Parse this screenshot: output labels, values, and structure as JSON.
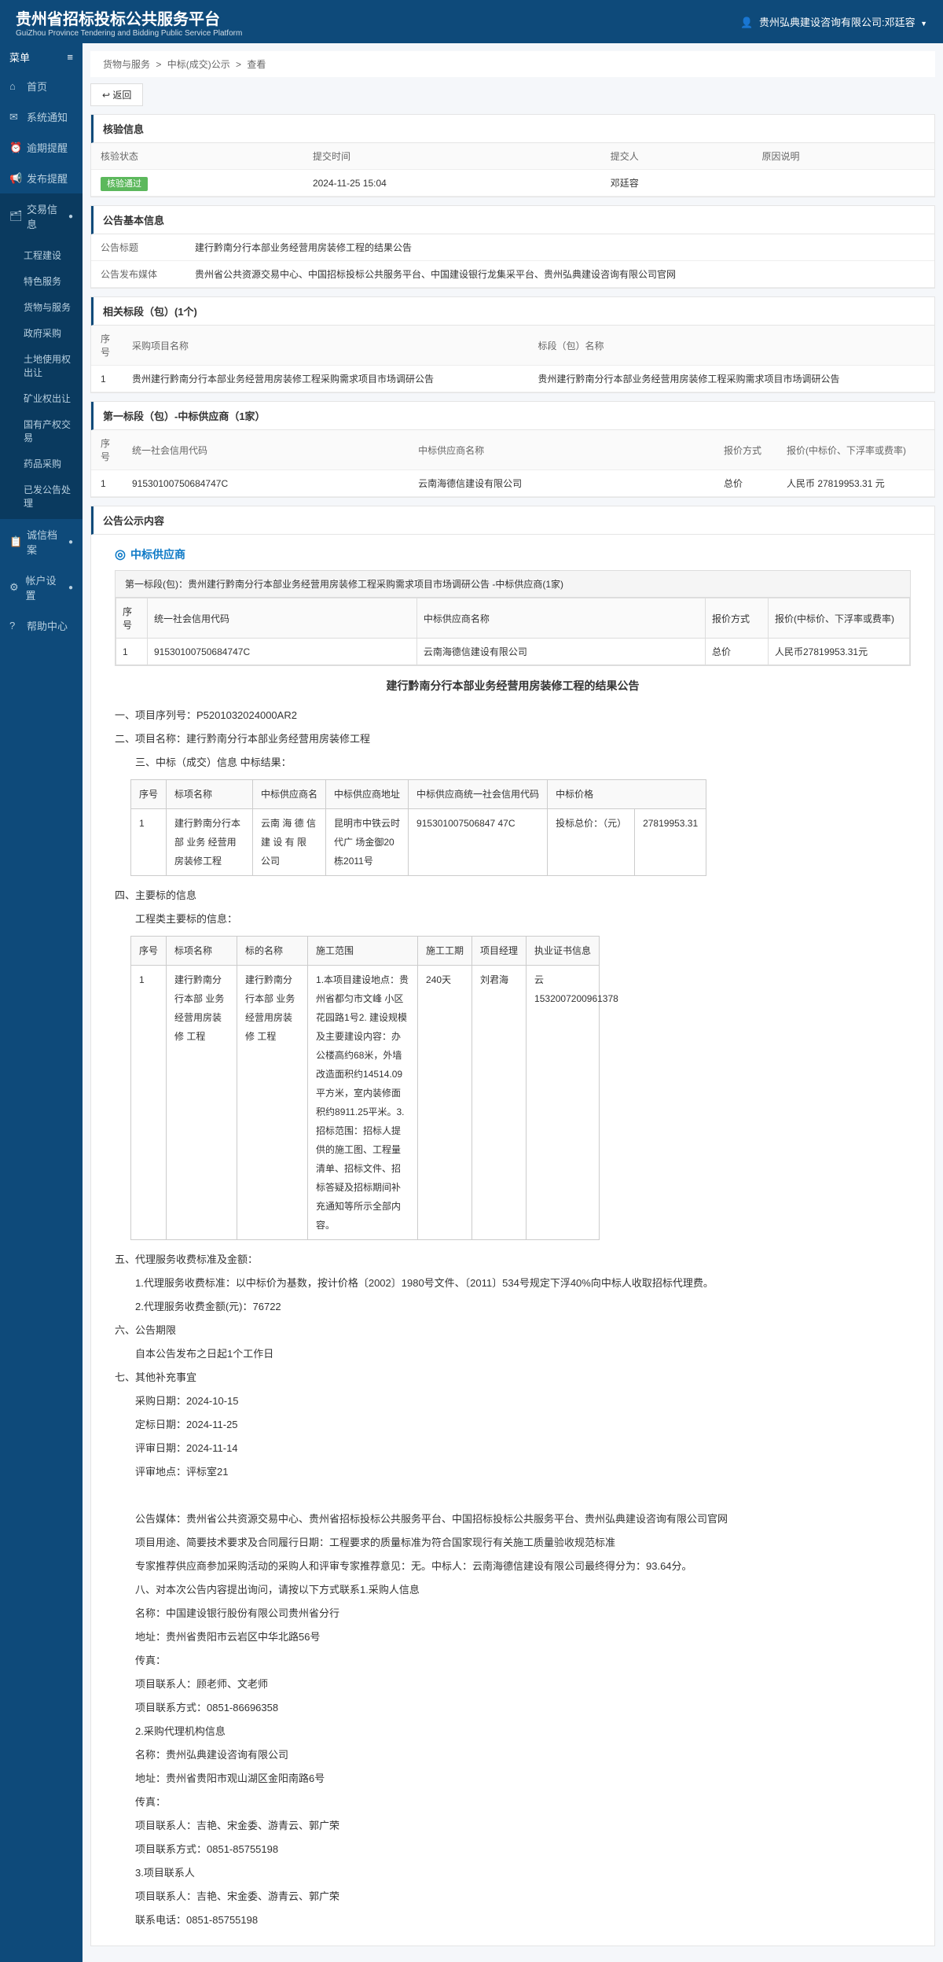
{
  "header": {
    "title_cn": "贵州省招标投标公共服务平台",
    "title_en": "GuiZhou Province Tendering and Bidding Public Service Platform",
    "user": "贵州弘典建设咨询有限公司:邓廷容"
  },
  "sidebar": {
    "title": "菜单",
    "items": [
      {
        "icon": "⌂",
        "label": "首页"
      },
      {
        "icon": "✉",
        "label": "系统通知"
      },
      {
        "icon": "⏰",
        "label": "逾期提醒"
      },
      {
        "icon": "📢",
        "label": "发布提醒"
      },
      {
        "icon": "🗂",
        "label": "交易信息",
        "active": true,
        "expand": "●"
      },
      {
        "icon": "📋",
        "label": "诚信档案",
        "expand": "●"
      },
      {
        "icon": "⚙",
        "label": "帐户设置",
        "expand": "●"
      },
      {
        "icon": "?",
        "label": "帮助中心"
      }
    ],
    "submenu": [
      "工程建设",
      "特色服务",
      "货物与服务",
      "政府采购",
      "土地使用权出让",
      "矿业权出让",
      "国有产权交易",
      "药品采购",
      "已发公告处理"
    ]
  },
  "breadcrumb": {
    "p1": "货物与服务",
    "p2": "中标(成交)公示",
    "p3": "查看"
  },
  "back_btn": "返回",
  "panel1": {
    "title": "核验信息",
    "h1": "核验状态",
    "h2": "提交时间",
    "h3": "提交人",
    "h4": "原因说明",
    "status": "核验通过",
    "time": "2024-11-25 15:04",
    "person": "邓廷容",
    "reason": ""
  },
  "panel2": {
    "title": "公告基本信息",
    "r1_label": "公告标题",
    "r1_val": "建行黔南分行本部业务经营用房装修工程的结果公告",
    "r2_label": "公告发布媒体",
    "r2_val": "贵州省公共资源交易中心、中国招标投标公共服务平台、中国建设银行龙集采平台、贵州弘典建设咨询有限公司官网"
  },
  "panel3": {
    "title": "相关标段（包）(1个)",
    "h1": "序号",
    "h2": "采购项目名称",
    "h3": "标段（包）名称",
    "r_no": "1",
    "r_name": "贵州建行黔南分行本部业务经营用房装修工程采购需求项目市场调研公告",
    "r_seg": "贵州建行黔南分行本部业务经营用房装修工程采购需求项目市场调研公告"
  },
  "panel4": {
    "title": "第一标段（包）-中标供应商（1家）",
    "h1": "序号",
    "h2": "统一社会信用代码",
    "h3": "中标供应商名称",
    "h4": "报价方式",
    "h5": "报价(中标价、下浮率或费率)",
    "r_no": "1",
    "r_code": "91530100750684747C",
    "r_name": "云南海德信建设有限公司",
    "r_type": "总价",
    "r_price": "人民币 27819953.31 元"
  },
  "panel5": {
    "title": "公告公示内容"
  },
  "ann": {
    "header": "中标供应商",
    "box_title": "第一标段(包)：贵州建行黔南分行本部业务经营用房装修工程采购需求项目市场调研公告 -中标供应商(1家)",
    "th1": "序号",
    "th2": "统一社会信用代码",
    "th3": "中标供应商名称",
    "th4": "报价方式",
    "th5": "报价(中标价、下浮率或费率)",
    "td1": "1",
    "td2": "91530100750684747C",
    "td3": "云南海德信建设有限公司",
    "td4": "总价",
    "td5": "人民币27819953.31元",
    "main_title": "建行黔南分行本部业务经营用房装修工程的结果公告",
    "p1": "一、项目序列号：P5201032024000AR2",
    "p2": "二、项目名称：建行黔南分行本部业务经营用房装修工程",
    "p3": "三、中标（成交）信息   中标结果：",
    "t1": {
      "h1": "序号",
      "h2": "标项名称",
      "h3": "中标供应商名",
      "h4": "中标供应商地址",
      "h5": "中标供应商统一社会信用代码",
      "h6": "中标价格",
      "r1": "1",
      "r2": "建行黔南分行本部 业务   经营用房装修工程",
      "r3": "云南 海 德 信 建   设 有 限 公司",
      "r4": "昆明市中铁云时代广  场金御20栋2011号",
      "r5": "915301007506847 47C",
      "r6": "投标总价：（元）",
      "r6b": "27819953.31"
    },
    "p4": "四、主要标的信息",
    "p4b": "工程类主要标的信息：",
    "t2": {
      "h1": "序号",
      "h2": "标项名称",
      "h3": "标的名称",
      "h4": "施工范围",
      "h5": "施工工期",
      "h6": "项目经理",
      "h7": "执业证书信息",
      "r1": "1",
      "r2": "建行黔南分行本部   业务经营用房装修   工程",
      "r3": "建行黔南分行本部   业务经营用房装修   工程",
      "r4": "1.本项目建设地点：贵州省都匀市文峰  小区花园路1号2.  建设规模及主要建设内容：办公楼高约68米，外墙改造面积约14514.09平方米，室内装修面积约8911.25平米。3.招标范围：招标人提供的施工图、工程量清单、招标文件、招标答疑及招标期间补充通知等所示全部内容。",
      "r5": "240天",
      "r6": "刘君海",
      "r7": "云1532007200961378"
    },
    "p5": "五、代理服务收费标准及金额：",
    "p5a": "1.代理服务收费标准：以中标价为基数，按计价格〔2002〕1980号文件、〔2011〕534号规定下浮40%向中标人收取招标代理费。",
    "p5b": "2.代理服务收费金额(元)：76722",
    "p6": "六、公告期限",
    "p6a": "自本公告发布之日起1个工作日",
    "p7": "七、其他补充事宜",
    "p7a": "采购日期：2024-10-15",
    "p7b": "定标日期：2024-11-25",
    "p7c": "评审日期：2024-11-14",
    "p7d": "评审地点：评标室21",
    "foot_lines": [
      "公告媒体：贵州省公共资源交易中心、贵州省招标投标公共服务平台、中国招标投标公共服务平台、贵州弘典建设咨询有限公司官网",
      "项目用途、简要技术要求及合同履行日期：工程要求的质量标准为符合国家现行有关施工质量验收规范标准",
      "专家推荐供应商参加采购活动的采购人和评审专家推荐意见：无。中标人：云南海德信建设有限公司最终得分为：93.64分。",
      "八、对本次公告内容提出询问，请按以下方式联系1.采购人信息",
      "名称：中国建设银行股份有限公司贵州省分行",
      "地址：贵州省贵阳市云岩区中华北路56号",
      "传真：",
      "项目联系人：顾老师、文老师",
      "项目联系方式：0851-86696358",
      "2.采购代理机构信息",
      "名称：贵州弘典建设咨询有限公司",
      "地址：贵州省贵阳市观山湖区金阳南路6号",
      "传真：",
      "项目联系人：吉艳、宋金委、游青云、郭广荣",
      "项目联系方式：0851-85755198",
      "3.项目联系人",
      "项目联系人：吉艳、宋金委、游青云、郭广荣",
      "联系电话：0851-85755198"
    ]
  }
}
